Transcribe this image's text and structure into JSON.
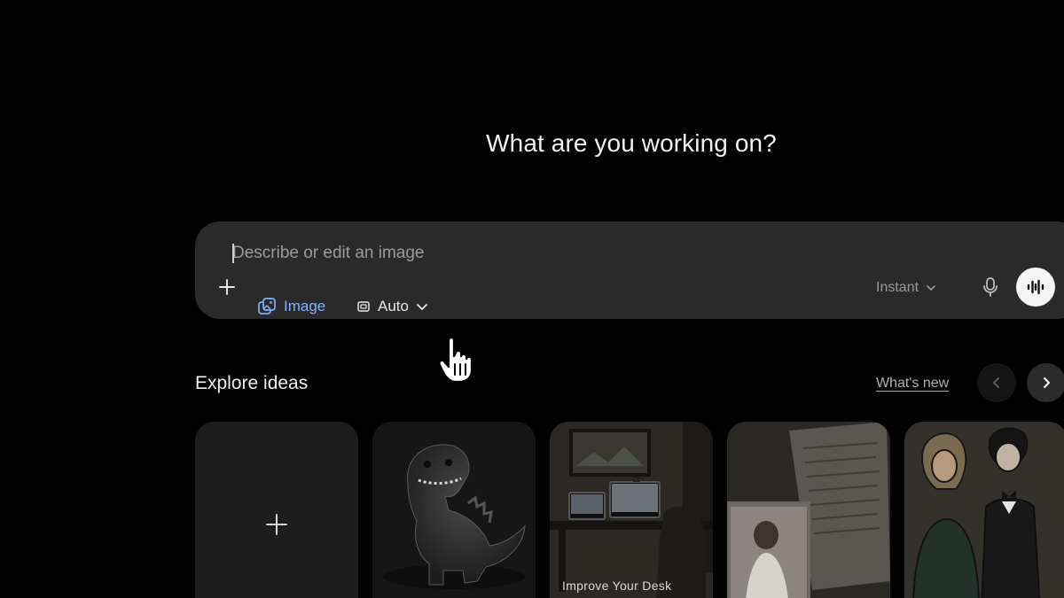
{
  "heading": "What are you working on?",
  "composer": {
    "placeholder": "Describe or edit an image",
    "image_chip": "Image",
    "aspect_chip": "Auto",
    "model_label": "Instant"
  },
  "explore": {
    "title": "Explore ideas",
    "whats_new": "What's new",
    "cards": [
      {
        "label": ""
      },
      {
        "label": ""
      },
      {
        "label": "Improve Your Desk"
      },
      {
        "label": ""
      },
      {
        "label": ""
      }
    ]
  },
  "colors": {
    "background": "#000000",
    "composer_bg": "#2a2a2a",
    "accent_blue": "#7fb3ff",
    "card_bg": "#1b1b1b"
  },
  "icons": [
    "plus-icon",
    "image-icon",
    "aspect-ratio-icon",
    "chevron-down-icon",
    "microphone-icon",
    "voice-waveform-icon",
    "chevron-left-icon",
    "chevron-right-icon",
    "hand-pointer-icon"
  ]
}
